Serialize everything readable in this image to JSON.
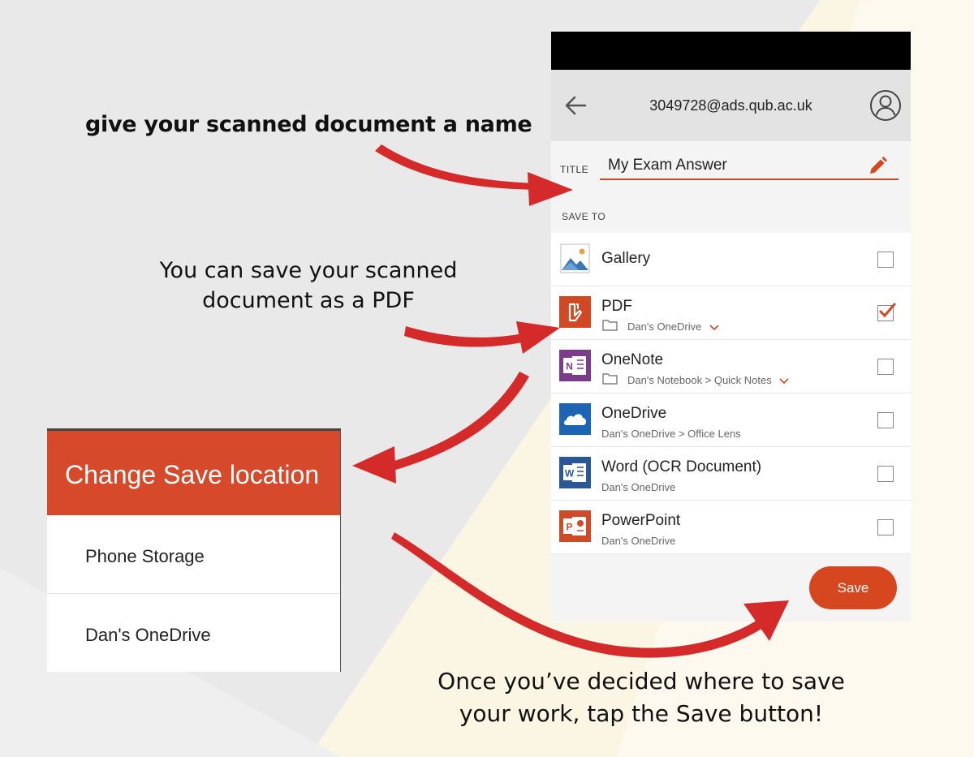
{
  "annotations": {
    "name_hint": "give your scanned document a name",
    "pdf_hint_line1": "You can save your scanned",
    "pdf_hint_line2": "document as a PDF",
    "save_hint_line1": "Once you’ve decided where to save",
    "save_hint_line2": "your work, tap the Save button!"
  },
  "header": {
    "account_email": "3049728@ads.qub.ac.uk"
  },
  "title_field": {
    "label": "TITLE",
    "value": "My Exam Answer"
  },
  "save_to": {
    "label": "SAVE TO",
    "destinations": [
      {
        "name": "Gallery",
        "sub": "",
        "folder": false,
        "chevron": false,
        "checked": false,
        "icon": "gallery-icon"
      },
      {
        "name": "PDF",
        "sub": "Dan's OneDrive",
        "folder": true,
        "chevron": true,
        "checked": true,
        "icon": "pdf-icon"
      },
      {
        "name": "OneNote",
        "sub": "Dan's Notebook > Quick Notes",
        "folder": true,
        "chevron": true,
        "checked": false,
        "icon": "onenote-icon"
      },
      {
        "name": "OneDrive",
        "sub": "Dan's OneDrive > Office Lens",
        "folder": false,
        "chevron": false,
        "checked": false,
        "icon": "onedrive-icon"
      },
      {
        "name": "Word (OCR Document)",
        "sub": "Dan's OneDrive",
        "folder": false,
        "chevron": false,
        "checked": false,
        "icon": "word-icon"
      },
      {
        "name": "PowerPoint",
        "sub": "Dan's OneDrive",
        "folder": false,
        "chevron": false,
        "checked": false,
        "icon": "powerpoint-icon"
      }
    ]
  },
  "save_button": "Save",
  "dialog": {
    "title": "Change Save location",
    "options": [
      "Phone Storage",
      "Dan's OneDrive"
    ]
  },
  "colors": {
    "accent": "#d6461f",
    "arrow": "#d42a2a",
    "dialog_header": "#d6492b"
  }
}
